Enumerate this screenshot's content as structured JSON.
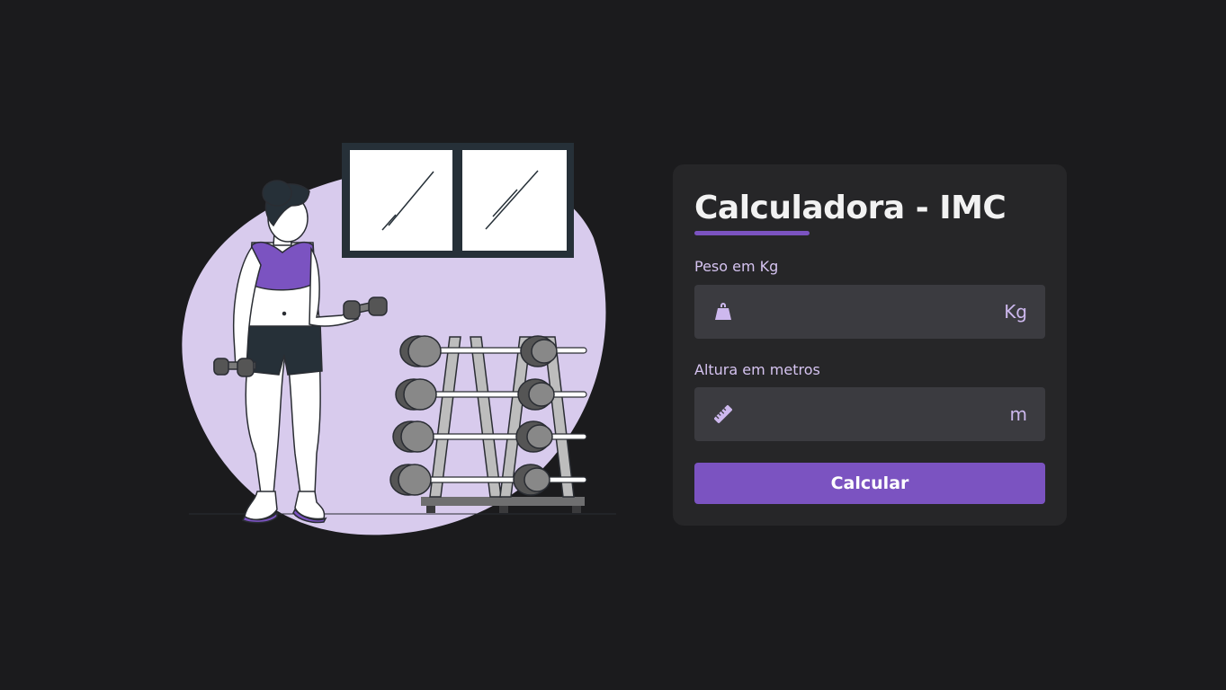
{
  "calculator": {
    "title": "Calculadora - IMC",
    "weight": {
      "label": "Peso em Kg",
      "value": "",
      "placeholder": "",
      "unit": "Kg",
      "icon": "weight-icon"
    },
    "height": {
      "label": "Altura em metros",
      "value": "",
      "placeholder": "",
      "unit": "m",
      "icon": "ruler-icon"
    },
    "button_label": "Calcular"
  },
  "illustration": {
    "description_icon": "woman-lifting-dumbbells-illustration"
  },
  "colors": {
    "background": "#1b1b1d",
    "card": "#262628",
    "field": "#3b3b40",
    "accent": "#7b53c1",
    "accent_light": "#d8cbed",
    "label": "#d5c3f0"
  }
}
